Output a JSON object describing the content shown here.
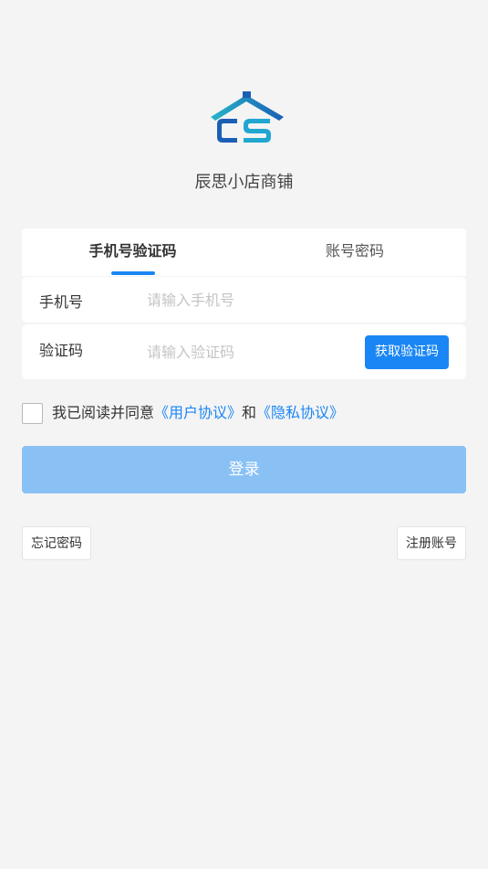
{
  "brand": {
    "logo_icon": "house-cs-logo-icon",
    "logo_letters": "CS",
    "shop_name": "辰思小店商铺",
    "colors": {
      "roof_dark": "#1a5fb4",
      "roof_light": "#26b5c9",
      "letter_dark": "#1a5fb4",
      "letter_light": "#20a6d0"
    }
  },
  "login_tabs": [
    {
      "label": "手机号验证码",
      "active": true
    },
    {
      "label": "账号密码",
      "active": false
    }
  ],
  "form": {
    "phone": {
      "label": "手机号",
      "value": "",
      "placeholder": "请输入手机号"
    },
    "code": {
      "label": "验证码",
      "value": "",
      "placeholder": "请输入验证码",
      "button_label": "获取验证码"
    }
  },
  "agreement": {
    "checked": false,
    "prefix": "我已阅读并同意",
    "user_agreement": "《用户协议》",
    "conjunction": "和",
    "privacy_policy": "《隐私协议》"
  },
  "actions": {
    "login_label": "登录",
    "forgot_label": "忘记密码",
    "register_label": "注册账号"
  },
  "theme": {
    "accent": "#1a86f5",
    "login_disabled": "#89c1f5",
    "background": "#f4f4f4"
  }
}
